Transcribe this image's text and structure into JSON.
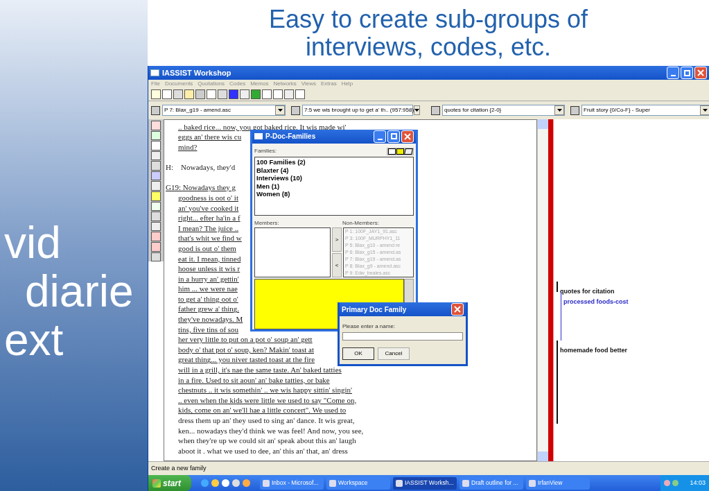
{
  "slide": {
    "title": "Easy to create sub-groups of interviews, codes, etc.",
    "background_words": [
      "vid",
      "diarie",
      "ext"
    ]
  },
  "window": {
    "title": "IASSIST Workshop"
  },
  "menu": [
    "File",
    "Documents",
    "Quotations",
    "Codes",
    "Memos",
    "Networks",
    "Views",
    "Extras",
    "Help"
  ],
  "selectors": [
    {
      "value": "P 7: Blax_g19 - amend.asc"
    },
    {
      "value": "7:5 we wis brought up to get a' th.. (957:958)"
    },
    {
      "value": "quotes for citation {2-0}"
    },
    {
      "value": "Fruit story {0/Co-F} - Super"
    }
  ],
  "document": {
    "lines": [
      {
        "kind": "text",
        "text": ".. baked rice... now, you got baked rice. It wis made wi'",
        "underlined": true
      },
      {
        "kind": "text",
        "text": "eggs an' there wis cu",
        "underlined": true
      },
      {
        "kind": "text",
        "text": "mind?",
        "underlined": true
      },
      {
        "kind": "blank"
      },
      {
        "kind": "speaker",
        "text": "H:    Nowadays, they'd",
        "underlined": false
      },
      {
        "kind": "blank"
      },
      {
        "kind": "speaker",
        "text": "G19: Nowadays they g",
        "underlined": true
      },
      {
        "kind": "text",
        "text": "goodness is oot o' it",
        "underlined": true
      },
      {
        "kind": "text",
        "text": "an' you've cooked it",
        "underlined": true
      },
      {
        "kind": "text",
        "text": "right... efter ha'in a f",
        "underlined": true
      },
      {
        "kind": "text",
        "text": "I mean? The juice ..",
        "underlined": true
      },
      {
        "kind": "text",
        "text": "that's whit we find w",
        "underlined": true
      },
      {
        "kind": "text",
        "text": "good is out o' them",
        "underlined": true
      },
      {
        "kind": "text",
        "text": "eat it. I mean, tinned",
        "underlined": true
      },
      {
        "kind": "text",
        "text": "hoose unless it wis r",
        "underlined": true
      },
      {
        "kind": "text",
        "text": "in a hurry an' gettin'",
        "underlined": true
      },
      {
        "kind": "text",
        "text": "him ... we were nae",
        "underlined": true
      },
      {
        "kind": "text",
        "text": "to get a' thing oot o'",
        "underlined": true
      },
      {
        "kind": "text",
        "text": "father grew a' thing.",
        "underlined": true
      },
      {
        "kind": "text",
        "text": "they've nowadays. M",
        "underlined": true
      },
      {
        "kind": "text",
        "text": "tins, five tins of sou",
        "underlined": true
      },
      {
        "kind": "text",
        "text": "her very little to put on a pot o' soup an' gett",
        "underlined": true
      },
      {
        "kind": "text",
        "text": "body o' that pot o' soup, ken? Makin' toast at",
        "underlined": true
      },
      {
        "kind": "text",
        "text": "great thing... you niver tasted toast at the fire",
        "underlined": true
      },
      {
        "kind": "text",
        "text": "will in a grill, it's nae the same taste. An' baked tatties",
        "underlined": true
      },
      {
        "kind": "text",
        "text": "in a fire. Used to sit aoun' an' bake tatties, or bake",
        "underlined": true
      },
      {
        "kind": "text",
        "text": "chestnuts .. it wis somethin' .. we wis happy sittin' singin'",
        "underlined": true
      },
      {
        "kind": "text",
        "text": ".. even when the kids were little we used to say \"Come on,",
        "underlined": true
      },
      {
        "kind": "text",
        "text": "kids, come on an' we'll hae a little concert\". We used to",
        "underlined": true
      },
      {
        "kind": "text",
        "text": "dress them up an' they used to sing an' dance. It wis great,",
        "underlined": false
      },
      {
        "kind": "text",
        "text": "ken... nowadays they'd think we was feel! And now, you see,",
        "underlined": false
      },
      {
        "kind": "text",
        "text": "when they're up we could sit an' speak about this an' laugh",
        "underlined": false
      },
      {
        "kind": "text",
        "text": "aboot it . what we used to dee, an' this an' that, an' dress",
        "underlined": false
      }
    ]
  },
  "margin": {
    "codes": [
      {
        "label": "quotes for citation",
        "color": "#111111"
      },
      {
        "label": "processed foods-cost",
        "color": "#2b2bc8"
      },
      {
        "label": "homemade food better",
        "color": "#111111"
      }
    ]
  },
  "families_dialog": {
    "title": "P-Doc-Families",
    "families_label": "Families:",
    "families": [
      "100 Families (2)",
      "Blaxter (4)",
      "Interviews (10)",
      "Men (1)",
      "Women (8)"
    ],
    "members_label": "Members:",
    "non_members_label": "Non-Members:",
    "move_buttons": [
      ">",
      "<"
    ],
    "non_members": [
      "P 1: 100F_JAY1_91.asc",
      "P 3: 100F_MURPHY1_11",
      "P 5: Blax_g10 - amend re",
      "P 6: Blax_g15 - amend.as",
      "P 7: Blax_g19 - amend.as",
      "P 8: Blax_g9 - amend.asc",
      "P 9: Edw_beales.asc"
    ]
  },
  "name_dialog": {
    "title": "Primary Doc Family",
    "prompt": "Please enter a name:",
    "buttons": [
      "OK",
      "Cancel"
    ]
  },
  "status_bar": "Create a new family",
  "taskbar": {
    "start": "start",
    "tasks": [
      {
        "label": "Inbox - Microsof...",
        "selected": false
      },
      {
        "label": "Workspace",
        "selected": false
      },
      {
        "label": "IASSIST Worksh...",
        "selected": true
      },
      {
        "label": "Draft outline for ...",
        "selected": false
      },
      {
        "label": "IrfanView",
        "selected": false
      }
    ],
    "clock": "14:03"
  }
}
